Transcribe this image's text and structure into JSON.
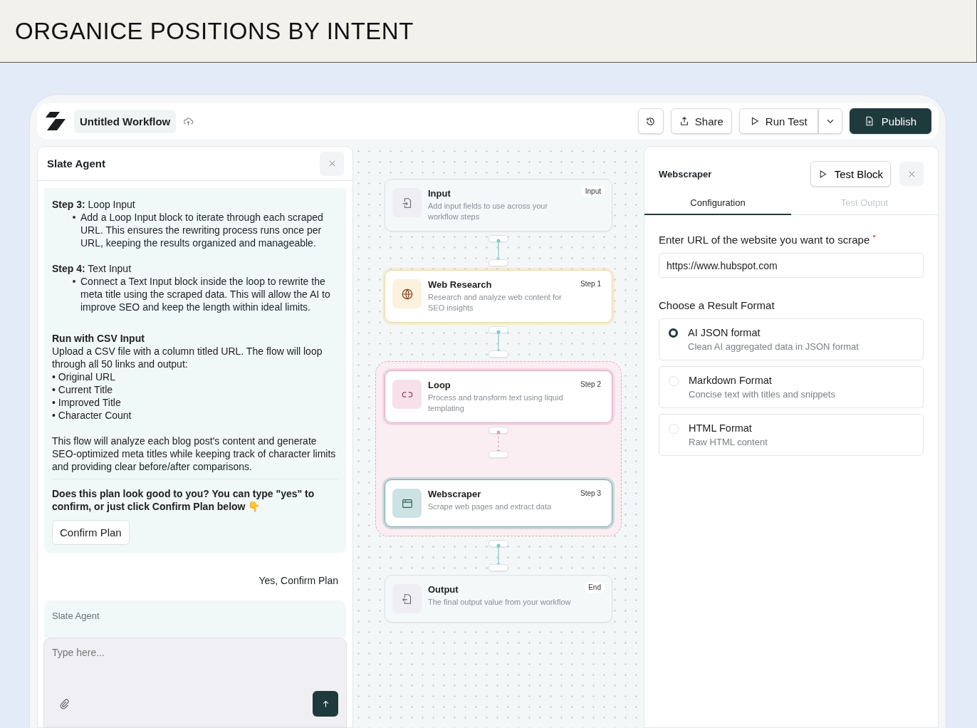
{
  "page_title": "ORGANICE POSITIONS BY INTENT",
  "topbar": {
    "workflow_name": "Untitled Workflow",
    "buttons": [
      {
        "kind": "history"
      },
      {
        "kind": "share",
        "label": "Share"
      },
      {
        "kind": "run",
        "label": "Run Test"
      },
      {
        "kind": "dropdown"
      },
      {
        "kind": "publish",
        "label": "Publish"
      }
    ]
  },
  "chat": {
    "title": "Slate Agent",
    "blocks": [
      {
        "kind": "step",
        "heading": "**Step 3:** Loop Input",
        "bullet": "Add a Loop Input block to iterate through each scraped URL. This ensures the rewriting process runs once per URL, keeping the results organized and manageable."
      },
      {
        "kind": "step",
        "heading": "**Step 4:** Text Input",
        "bullet": "Connect a Text Input block inside the loop to rewrite the meta title using the scraped data. This will allow the AI to improve SEO and keep the length within ideal limits."
      },
      {
        "kind": "heading",
        "text": "Run with CSV Input"
      },
      {
        "kind": "paragraph",
        "text": "Upload a CSV file with a column titled URL. The flow will loop through all 50 links and output:"
      },
      {
        "kind": "list",
        "items": [
          "• Original URL",
          "• Current Title",
          "• Improved Title",
          "• Character Count"
        ]
      },
      {
        "kind": "paragraph",
        "text": "This flow will analyze each blog post's content and generate SEO-optimized meta titles while keeping track of character limits and providing clear before/after comparisons."
      },
      {
        "kind": "question",
        "text": "Does this plan look good to you? You can type \"yes\" to confirm, or just click Confirm Plan below 👇"
      },
      {
        "kind": "button",
        "text": "Confirm Plan"
      }
    ],
    "user_reply": "Yes, Confirm Plan",
    "next_sender": "Slate Agent",
    "input_placeholder": "Type here..."
  },
  "canvas": {
    "nodes": [
      {
        "kind": "input",
        "title": "Input",
        "description": "Add input fields to use across your workflow steps",
        "badge": "Input"
      },
      {
        "kind": "research",
        "title": "Web Research",
        "description": "Research and analyze web content for SEO insights",
        "badge": "Step 1",
        "color": "#f2d99a"
      },
      {
        "kind": "loop_group",
        "children": [
          {
            "kind": "loop",
            "title": "Loop",
            "description": "Process and transform text using liquid templating",
            "badge": "Step 2",
            "color": "#e3a3bf"
          },
          {
            "kind": "scraper",
            "title": "Webscraper",
            "description": "Scrape web pages and extract data",
            "badge": "Step 3",
            "color": "#6aa9a8"
          }
        ]
      },
      {
        "kind": "output",
        "title": "Output",
        "description": "The final output value from your workflow",
        "badge": "End"
      }
    ]
  },
  "inspector": {
    "title": "Webscraper",
    "test_button": "Test Block",
    "tabs": [
      {
        "label": "Configuration",
        "selected": true
      },
      {
        "label": "Test Output",
        "selected": false
      }
    ],
    "url_label": "Enter URL of the website you want to scrape",
    "url_required": true,
    "url_value": "https://www.hubspot.com",
    "format_label": "Choose a Result Format",
    "formats": [
      {
        "title": "AI JSON format",
        "description": "Clean AI aggregated data in JSON format",
        "selected": true
      },
      {
        "title": "Markdown Format",
        "description": "Concise text with titles and snippets",
        "selected": false
      },
      {
        "title": "HTML Format",
        "description": "Raw HTML content",
        "selected": false
      }
    ]
  }
}
